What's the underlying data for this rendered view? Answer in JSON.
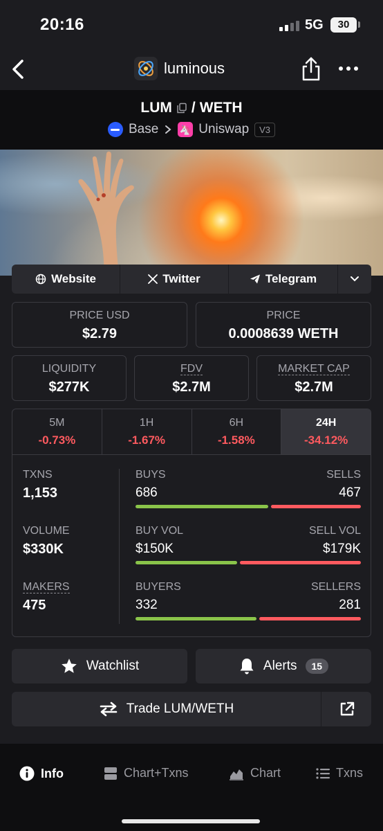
{
  "status_bar": {
    "time": "20:16",
    "network": "5G",
    "battery": "30"
  },
  "nav": {
    "app_name": "luminous"
  },
  "pair": {
    "base": "LUM",
    "separator": "/",
    "quote": "WETH",
    "chain": "Base",
    "dex": "Uniswap",
    "version": "V3"
  },
  "links": [
    {
      "label": "Website",
      "icon": "globe-icon"
    },
    {
      "label": "Twitter",
      "icon": "x-logo-icon"
    },
    {
      "label": "Telegram",
      "icon": "telegram-icon"
    }
  ],
  "price_usd": {
    "label": "PRICE USD",
    "value": "$2.79"
  },
  "price": {
    "label": "PRICE",
    "value": "0.0008639 WETH"
  },
  "liquidity": {
    "label": "LIQUIDITY",
    "value": "$277K"
  },
  "fdv": {
    "label": "FDV",
    "value": "$2.7M"
  },
  "market_cap": {
    "label": "MARKET CAP",
    "value": "$2.7M"
  },
  "timeframes": [
    {
      "label": "5M",
      "value": "-0.73%"
    },
    {
      "label": "1H",
      "value": "-1.67%"
    },
    {
      "label": "6H",
      "value": "-1.58%"
    },
    {
      "label": "24H",
      "value": "-34.12%",
      "active": true
    }
  ],
  "txns": {
    "label": "TXNS",
    "value": "1,153",
    "buys_label": "BUYS",
    "buys": "686",
    "sells_label": "SELLS",
    "sells": "467",
    "buy_share": 0.595
  },
  "volume": {
    "label": "VOLUME",
    "value": "$330K",
    "buy_label": "BUY VOL",
    "buy": "$150K",
    "sell_label": "SELL VOL",
    "sell": "$179K",
    "buy_share": 0.456
  },
  "makers": {
    "label": "MAKERS",
    "value": "475",
    "buyers_label": "BUYERS",
    "buyers": "332",
    "sellers_label": "SELLERS",
    "sellers": "281",
    "buy_share": 0.542
  },
  "actions": {
    "watchlist": "Watchlist",
    "alerts": "Alerts",
    "alerts_count": "15",
    "trade": "Trade LUM/WETH"
  },
  "tabs": [
    {
      "label": "Info",
      "icon": "info-icon",
      "active": true
    },
    {
      "label": "Chart+Txns",
      "icon": "split-view-icon"
    },
    {
      "label": "Chart",
      "icon": "area-chart-icon"
    },
    {
      "label": "Txns",
      "icon": "list-icon"
    }
  ],
  "colors": {
    "background": "#1c1c20",
    "positive": "#8ac44a",
    "negative": "#ff5a5f",
    "chain_blue": "#2a5cff",
    "uniswap_pink": "#ff3fa9"
  }
}
